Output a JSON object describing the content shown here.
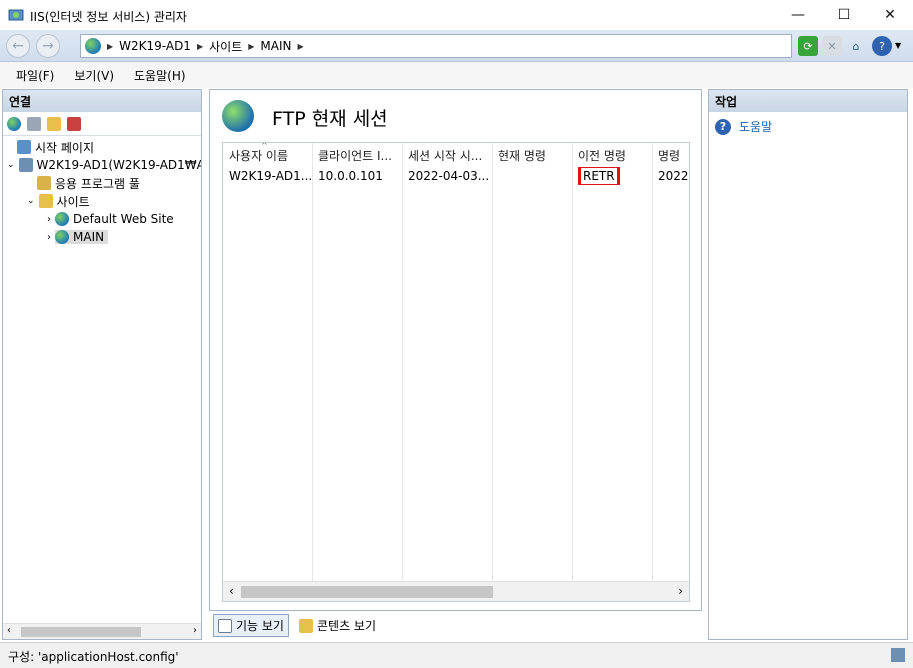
{
  "window": {
    "title": "IIS(인터넷 정보 서비스) 관리자",
    "minimize": "—",
    "maximize": "☐",
    "close": "✕"
  },
  "address": {
    "crumbs": [
      "W2K19-AD1",
      "사이트",
      "MAIN"
    ]
  },
  "menu": {
    "items": [
      "파일(F)",
      "보기(V)",
      "도움말(H)"
    ]
  },
  "connections": {
    "header": "연결",
    "tree": {
      "start_page": "시작 페이지",
      "server": "W2K19-AD1(W2K19-AD1₩A",
      "app_pools": "응용 프로그램 풀",
      "sites": "사이트",
      "default_site": "Default Web Site",
      "main_site": "MAIN"
    }
  },
  "main": {
    "title": "FTP 현재 세션",
    "columns": [
      "사용자 이름",
      "클라이언트 I...",
      "세션 시작 시...",
      "현재 명령",
      "이전 명령",
      "명령"
    ],
    "rows": [
      [
        "W2K19-AD1...",
        "10.0.0.101",
        "2022-04-03...",
        "",
        "RETR",
        "2022"
      ]
    ],
    "tabs": [
      "기능 보기",
      "콘텐츠 보기"
    ]
  },
  "actions": {
    "header": "작업",
    "help": "도움말"
  },
  "status": {
    "text": "구성: 'applicationHost.config'"
  },
  "colors": {
    "highlight_box": "#e0131c",
    "link": "#1f5fa8"
  }
}
